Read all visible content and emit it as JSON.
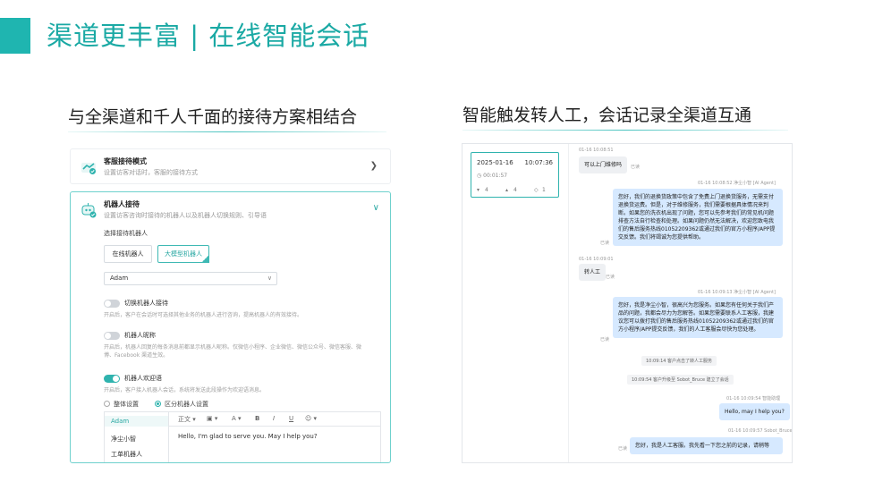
{
  "slide": {
    "title": "渠道更丰富 | 在线智能会话",
    "left_subtitle": "与全渠道和千人千面的接待方案相结合",
    "right_subtitle": "智能触发转人工，会话记录全渠道互通"
  },
  "colors": {
    "accent": "#1fb5b0",
    "bubble_bot": "#d6e9ff",
    "bubble_customer": "#eef0f3"
  },
  "settings": {
    "mode_card": {
      "title": "客服接待模式",
      "desc": "设置访客对话时，客服的接待方式",
      "icon": "handshake-icon"
    },
    "robot_card": {
      "title": "机器人接待",
      "desc": "设置访客咨询时接待的机器人以及机器人切换规则、引导语",
      "icon": "robot-icon",
      "choose_label": "选择接待机器人",
      "robot_options": [
        "在线机器人",
        "大模型机器人"
      ],
      "selected_robot": "Adam",
      "toggles": [
        {
          "label": "切换机器人接待",
          "desc": "开启后，客户在会话时可选择其他业务的机器人进行咨询，提高机器人的有效接待。",
          "on": false
        },
        {
          "label": "机器人昵称",
          "desc": "开启后，机器人回复的每条消息前都显示机器人昵称。仅微信小程序、企业微信、微信公众号、微信客服、微博、Facebook 渠道生效。",
          "on": false
        },
        {
          "label": "机器人欢迎语",
          "desc": "开启后，客户接入机器人会话，系统将发送此段操作为欢迎语消息。",
          "on": true
        }
      ],
      "radio_options": [
        "整体设置",
        "区分机器人设置"
      ],
      "robot_list": [
        "Adam",
        "净尘小智",
        "工单机器人"
      ],
      "toolbar": [
        "正文 ▾",
        "▣ ▾",
        "A ▾",
        "B",
        "I",
        "U",
        "☺ ▾"
      ],
      "welcome_text": "Hello, I'm glad to serve you. May I help you?"
    }
  },
  "session": {
    "date": "2025-01-16",
    "time": "10:07:36",
    "duration": "00:01:57",
    "stats": [
      "4",
      "4",
      "1"
    ]
  },
  "chat": {
    "read_label": "已读",
    "messages": [
      {
        "meta": "01-16 10:08:51",
        "text": "可以上门维修吗"
      },
      {
        "meta": "01-16 10:08:52  净尘小智 [AI Agent]",
        "text": "您好，我们的退换货政策中包含了免费上门退换货服务，无需支付退换货运费。但是，对于维修服务，我们需要根据具体情况来判断。如果您的洗衣机出现了问题，您可以先参考我们的常见机问题排查方法自行检查和处理。如果问题仍然无法解决，欢迎您致电我们的售后服务热线01052209362或通过我们的官方小程序/APP提交反馈。我们将竭诚为您提供帮助。"
      },
      {
        "meta": "01-16 10:09:01",
        "text": "转人工"
      },
      {
        "meta": "01-16 10:09:13  净尘小智 [AI Agent]",
        "text": "您好，我是净尘小智，很高兴为您服务。如果您有任何关于我们产品的问题，我都会尽力为您解答。如果您需要联系人工客服，我建议您可以拨打我们的售后服务热线01052209362或通过我们的官方小程序/APP提交反馈，我们的人工客服会尽快为您处理。"
      },
      {
        "system": "10:09:14 客户点击了转人工服务"
      },
      {
        "system": "10:09:54 客户升级至 Sobot_Bruce 建立了会话"
      },
      {
        "meta": "01-16 10:09:54  智能助理",
        "text": "Hello, may I help you?"
      },
      {
        "meta": "01-16 10:09:57  Sobot_Bruce",
        "text": "您好，我是人工客服。我先看一下您之前的记录，请稍等"
      }
    ]
  }
}
